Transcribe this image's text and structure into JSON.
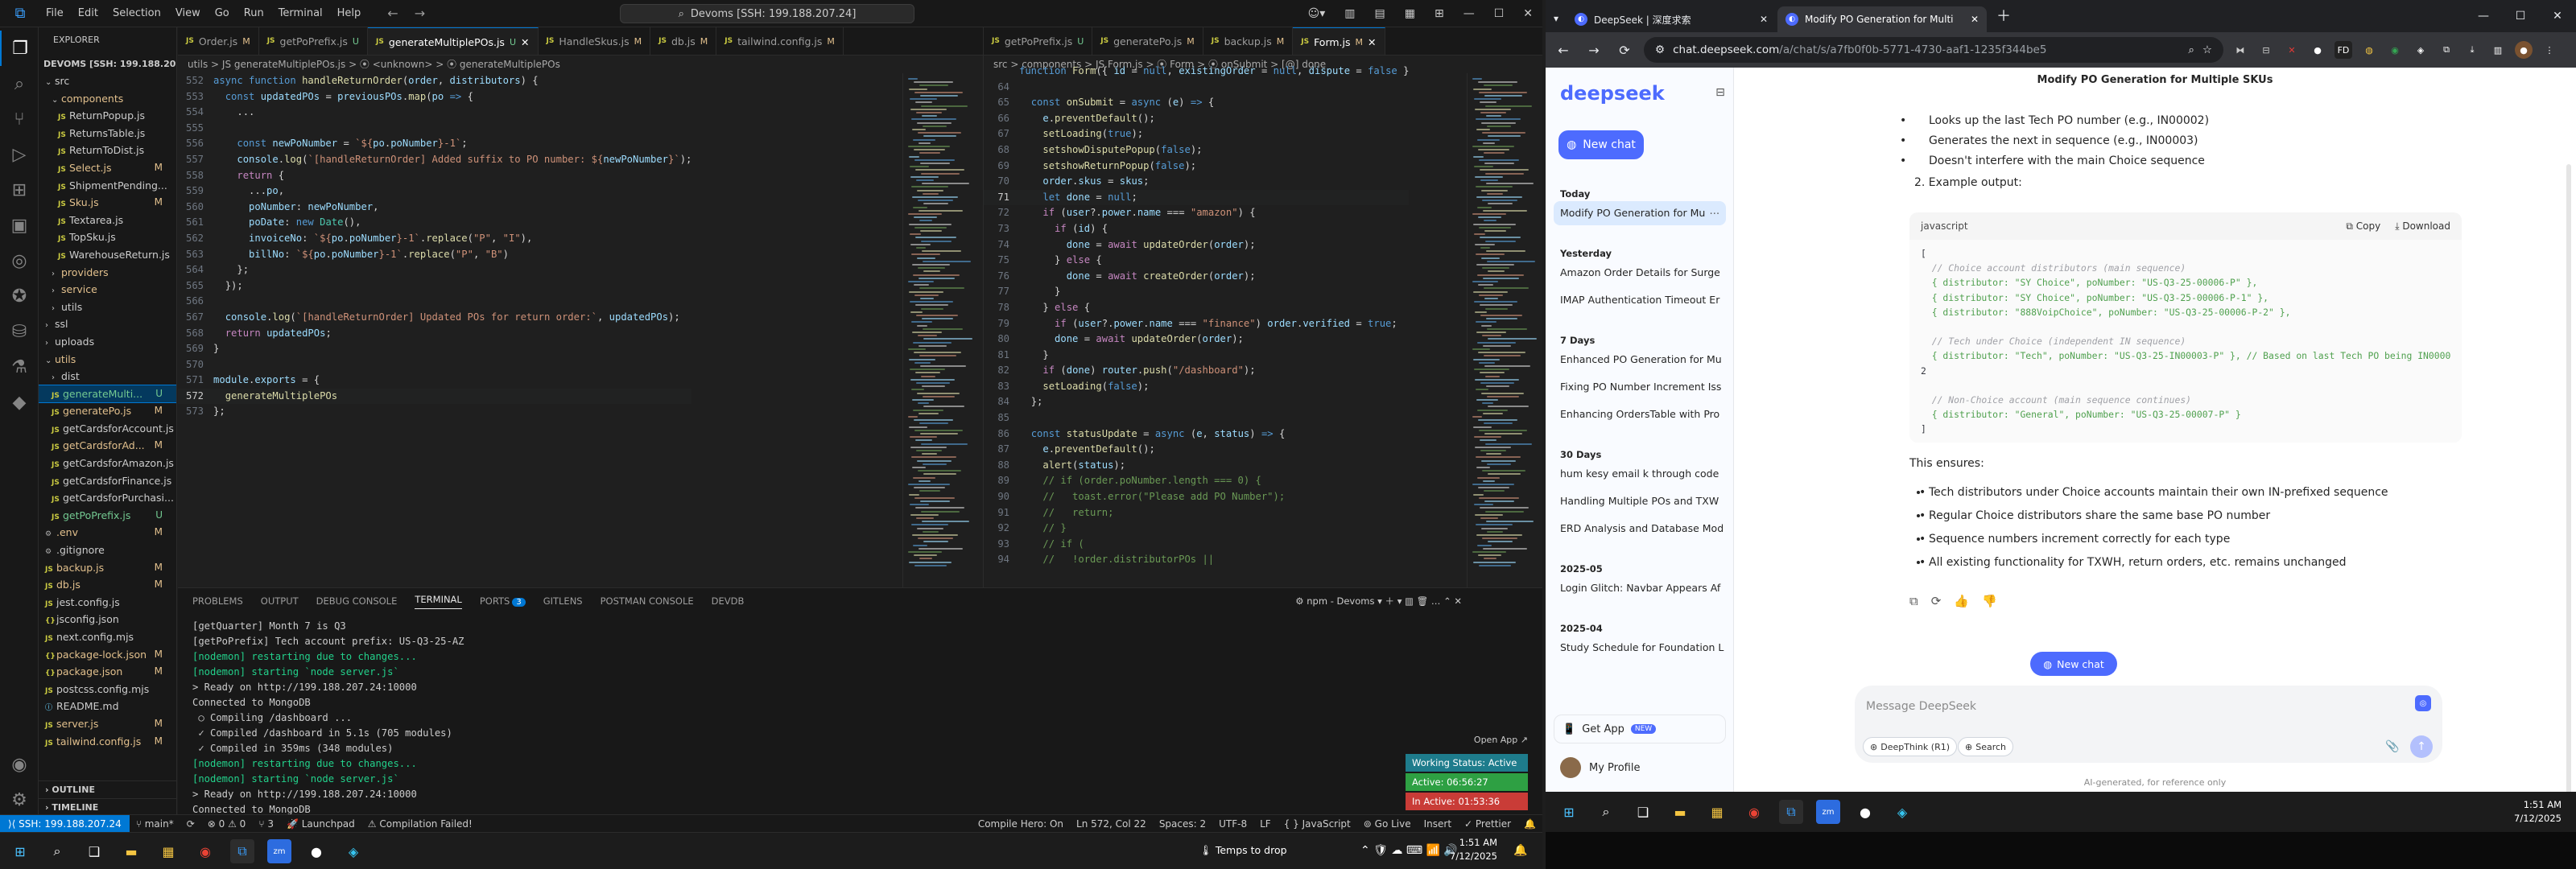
{
  "vscode": {
    "menu": [
      "File",
      "Edit",
      "Selection",
      "View",
      "Go",
      "Run",
      "Terminal",
      "Help"
    ],
    "command_center": "Devoms [SSH: 199.188.207.24]",
    "explorer_label": "EXPLORER",
    "project": "DEVOMS [SSH: 199.188.20...",
    "tree": [
      {
        "label": "src",
        "kind": "folder",
        "indent": 1,
        "open": true,
        "status": "",
        "color": "c-fold"
      },
      {
        "label": "components",
        "kind": "folder",
        "indent": 2,
        "open": true,
        "status": "",
        "color": "c-yellow"
      },
      {
        "label": "ReturnPopup.js",
        "kind": "js",
        "indent": 3,
        "status": "",
        "color": "c-fold"
      },
      {
        "label": "ReturnsTable.js",
        "kind": "js",
        "indent": 3,
        "status": "",
        "color": "c-fold"
      },
      {
        "label": "ReturnToDist.js",
        "kind": "js",
        "indent": 3,
        "status": "",
        "color": "c-fold"
      },
      {
        "label": "Select.js",
        "kind": "js",
        "indent": 3,
        "status": "M",
        "color": "c-mod"
      },
      {
        "label": "ShipmentPending...",
        "kind": "js",
        "indent": 3,
        "status": "",
        "color": "c-fold"
      },
      {
        "label": "Sku.js",
        "kind": "js",
        "indent": 3,
        "status": "M",
        "color": "c-mod"
      },
      {
        "label": "Textarea.js",
        "kind": "js",
        "indent": 3,
        "status": "",
        "color": "c-fold"
      },
      {
        "label": "TopSku.js",
        "kind": "js",
        "indent": 3,
        "status": "",
        "color": "c-fold"
      },
      {
        "label": "WarehouseReturn.js",
        "kind": "js",
        "indent": 3,
        "status": "",
        "color": "c-fold"
      },
      {
        "label": "providers",
        "kind": "folder",
        "indent": 2,
        "open": false,
        "status": "",
        "color": "c-yellow"
      },
      {
        "label": "service",
        "kind": "folder",
        "indent": 2,
        "open": false,
        "status": "",
        "color": "c-yellow"
      },
      {
        "label": "utils",
        "kind": "folder",
        "indent": 2,
        "open": false,
        "status": "",
        "color": "c-fold"
      },
      {
        "label": "ssl",
        "kind": "folder",
        "indent": 1,
        "open": false,
        "status": "",
        "color": "c-fold"
      },
      {
        "label": "uploads",
        "kind": "folder",
        "indent": 1,
        "open": false,
        "status": "",
        "color": "c-fold"
      },
      {
        "label": "utils",
        "kind": "folder",
        "indent": 1,
        "open": true,
        "status": "",
        "color": "c-yellow"
      },
      {
        "label": "dist",
        "kind": "folder",
        "indent": 2,
        "open": false,
        "status": "",
        "color": "c-fold"
      },
      {
        "label": "generateMulti...",
        "kind": "js",
        "indent": 2,
        "status": "U",
        "color": "c-un",
        "selected": true
      },
      {
        "label": "generatePo.js",
        "kind": "js",
        "indent": 2,
        "status": "M",
        "color": "c-mod"
      },
      {
        "label": "getCardsforAccount.js",
        "kind": "js",
        "indent": 2,
        "status": "",
        "color": "c-fold"
      },
      {
        "label": "getCardsforAd...",
        "kind": "js",
        "indent": 2,
        "status": "M",
        "color": "c-mod"
      },
      {
        "label": "getCardsforAmazon.js",
        "kind": "js",
        "indent": 2,
        "status": "",
        "color": "c-fold"
      },
      {
        "label": "getCardsforFinance.js",
        "kind": "js",
        "indent": 2,
        "status": "",
        "color": "c-fold"
      },
      {
        "label": "getCardsforPurchasi...",
        "kind": "js",
        "indent": 2,
        "status": "",
        "color": "c-fold"
      },
      {
        "label": "getPoPrefix.js",
        "kind": "js",
        "indent": 2,
        "status": "U",
        "color": "c-un"
      },
      {
        "label": ".env",
        "kind": "file",
        "indent": 1,
        "status": "M",
        "color": "c-mod"
      },
      {
        "label": ".gitignore",
        "kind": "file",
        "indent": 1,
        "status": "",
        "color": "c-fold"
      },
      {
        "label": "backup.js",
        "kind": "js",
        "indent": 1,
        "status": "M",
        "color": "c-mod"
      },
      {
        "label": "db.js",
        "kind": "js",
        "indent": 1,
        "status": "M",
        "color": "c-mod"
      },
      {
        "label": "jest.config.js",
        "kind": "js",
        "indent": 1,
        "status": "",
        "color": "c-fold"
      },
      {
        "label": "jsconfig.json",
        "kind": "json",
        "indent": 1,
        "status": "",
        "color": "c-fold"
      },
      {
        "label": "next.config.mjs",
        "kind": "js",
        "indent": 1,
        "status": "",
        "color": "c-fold"
      },
      {
        "label": "package-lock.json",
        "kind": "json",
        "indent": 1,
        "status": "M",
        "color": "c-mod"
      },
      {
        "label": "package.json",
        "kind": "json",
        "indent": 1,
        "status": "M",
        "color": "c-mod"
      },
      {
        "label": "postcss.config.mjs",
        "kind": "js",
        "indent": 1,
        "status": "",
        "color": "c-fold"
      },
      {
        "label": "README.md",
        "kind": "md",
        "indent": 1,
        "status": "",
        "color": "c-fold"
      },
      {
        "label": "server.js",
        "kind": "js",
        "indent": 1,
        "status": "M",
        "color": "c-mod"
      },
      {
        "label": "tailwind.config.js",
        "kind": "js",
        "indent": 1,
        "status": "M",
        "color": "c-mod"
      }
    ],
    "outline": "OUTLINE",
    "timeline": "TIMELINE",
    "tabs_left": [
      {
        "label": "Order.js",
        "status": "M",
        "active": false
      },
      {
        "label": "getPoPrefix.js",
        "status": "U",
        "active": false
      },
      {
        "label": "generateMultiplePOs.js",
        "status": "U",
        "active": true
      },
      {
        "label": "HandleSkus.js",
        "status": "M",
        "active": false
      },
      {
        "label": "db.js",
        "status": "M",
        "active": false
      },
      {
        "label": "tailwind.config.js",
        "status": "M",
        "active": false
      }
    ],
    "tabs_right": [
      {
        "label": "getPoPrefix.js",
        "status": "U",
        "active": false
      },
      {
        "label": "generatePo.js",
        "status": "M",
        "active": false
      },
      {
        "label": "backup.js",
        "status": "M",
        "active": false
      },
      {
        "label": "Form.js",
        "status": "M",
        "active": true
      }
    ],
    "breadcrumb_left": "utils > JS generateMultiplePOs.js > ⦿ <unknown> > ⦿ generateMultiplePOs",
    "breadcrumb_right": "src > components > JS Form.js > ⦿ Form > ⦿ onSubmit > [@] done",
    "panel_tabs": [
      "PROBLEMS",
      "OUTPUT",
      "DEBUG CONSOLE",
      "TERMINAL",
      "PORTS",
      "GITLENS",
      "POSTMAN CONSOLE",
      "DEVDB"
    ],
    "ports_badge": "3",
    "terminal_name": "npm - Devoms",
    "terminal_lines": [
      {
        "t": "[getQuarter] Month 7 is Q3",
        "c": "t-w"
      },
      {
        "t": "[getPoPrefix] Tech account prefix: US-Q3-25-AZ",
        "c": "t-w"
      },
      {
        "t": "[nodemon] restarting due to changes...",
        "c": "t-g"
      },
      {
        "t": "[nodemon] starting `node server.js`",
        "c": "t-g"
      },
      {
        "t": "> Ready on http://199.188.207.24:10000",
        "c": "t-w"
      },
      {
        "t": "Connected to MongoDB",
        "c": "t-w"
      },
      {
        "t": " ○ Compiling /dashboard ...",
        "c": "t-w"
      },
      {
        "t": " ✓ Compiled /dashboard in 5.1s (705 modules)",
        "c": "t-w"
      },
      {
        "t": " ✓ Compiled in 359ms (348 modules)",
        "c": "t-w"
      },
      {
        "t": "[nodemon] restarting due to changes...",
        "c": "t-g"
      },
      {
        "t": "[nodemon] starting `node server.js`",
        "c": "t-g"
      },
      {
        "t": "> Ready on http://199.188.207.24:10000",
        "c": "t-w"
      },
      {
        "t": "Connected to MongoDB",
        "c": "t-w"
      },
      {
        "t": "▌",
        "c": "t-w"
      }
    ],
    "open_app": "Open App ↗",
    "working_status": "Working Status: Active",
    "active_time": "Active: 06:56:27",
    "inactive_time": "In Active: 01:53:36",
    "status_bar": {
      "remote": "⟩⟨ SSH: 199.188.207.24",
      "branch": "main*",
      "errors": "⊗ 0 ⚠ 0",
      "ports": "⑂ 3",
      "launchpad": "Launchpad",
      "compile": "Compilation Failed!",
      "compile_hero": "Compile Hero: On",
      "position": "Ln 572, Col 22",
      "spaces": "Spaces: 2",
      "encoding": "UTF-8",
      "eol": "LF",
      "language": "{ } JavaScript",
      "golive": "Go Live",
      "insert": "Insert",
      "prettier": "Prettier",
      "temps": "Temps to drop"
    },
    "clock_time": "1:51 AM",
    "clock_date": "7/12/2025"
  },
  "browser": {
    "tabs": [
      {
        "label": "DeepSeek | 深度求索",
        "active": false
      },
      {
        "label": "Modify PO Generation for Multi",
        "active": true
      }
    ],
    "url_host": "chat.deepseek.com",
    "url_path": "/a/chat/s/a7fb0f0b-5771-4730-aaf1-1235f344be5",
    "logo": "deepseek",
    "new_chat": "New chat",
    "history": [
      {
        "section": "Today",
        "items": [
          "Modify PO Generation for Mu"
        ]
      },
      {
        "section": "Yesterday",
        "items": [
          "Amazon Order Details for Surge",
          "IMAP Authentication Timeout Er"
        ]
      },
      {
        "section": "7 Days",
        "items": [
          "Enhanced PO Generation for Mu",
          "Fixing PO Number Increment Iss",
          "Enhancing OrdersTable with Pro"
        ]
      },
      {
        "section": "30 Days",
        "items": [
          "hum kesy email k through code",
          "Handling Multiple POs and TXW",
          "ERD Analysis and Database Mod"
        ]
      },
      {
        "section": "2025-05",
        "items": [
          "Login Glitch: Navbar Appears Af"
        ]
      },
      {
        "section": "2025-04",
        "items": [
          "Study Schedule for Foundation L"
        ]
      }
    ],
    "get_app": "Get App",
    "new_badge": "NEW",
    "profile": "My Profile",
    "chat_title": "Modify PO Generation for Multiple SKUs",
    "bullets_top": [
      "Looks up the last Tech PO number (e.g., IN00002)",
      "Generates the next in sequence (e.g., IN00003)",
      "Doesn't interfere with the main Choice sequence"
    ],
    "example_label": "2. Example output:",
    "code_lang": "javascript",
    "copy_label": "Copy",
    "download_label": "Download",
    "code_lines": [
      {
        "t": "[",
        "c": "d-p"
      },
      {
        "t": "  // Choice account distributors (main sequence)",
        "c": "d-cm"
      },
      {
        "t": "  { distributor: \"SY Choice\", poNumber: \"US-Q3-25-00006-P\" },",
        "c": "d-s"
      },
      {
        "t": "  { distributor: \"SY Choice\", poNumber: \"US-Q3-25-00006-P-1\" },",
        "c": "d-s"
      },
      {
        "t": "  { distributor: \"888VoipChoice\", poNumber: \"US-Q3-25-00006-P-2\" },",
        "c": "d-s"
      },
      {
        "t": "",
        "c": "d-p"
      },
      {
        "t": "  // Tech under Choice (independent IN sequence)",
        "c": "d-cm"
      },
      {
        "t": "  { distributor: \"Tech\", poNumber: \"US-Q3-25-IN00003-P\" }, // Based on last Tech PO being IN0000",
        "c": "d-s"
      },
      {
        "t": "2",
        "c": "d-p"
      },
      {
        "t": "",
        "c": "d-p"
      },
      {
        "t": "  // Non-Choice account (main sequence continues)",
        "c": "d-cm"
      },
      {
        "t": "  { distributor: \"General\", poNumber: \"US-Q3-25-00007-P\" }",
        "c": "d-s"
      },
      {
        "t": "]",
        "c": "d-p"
      }
    ],
    "ensures_label": "This ensures:",
    "ensures": [
      "Tech distributors under Choice accounts maintain their own IN-prefixed sequence",
      "Regular Choice distributors share the same base PO number",
      "Sequence numbers increment correctly for each type",
      "All existing functionality for TXWH, return orders, etc. remains unchanged"
    ],
    "new_chat_float": "New chat",
    "input_placeholder": "Message DeepSeek",
    "deepthink": "DeepThink (R1)",
    "search": "Search",
    "disclaimer": "AI-generated, for reference only",
    "clock_time": "1:51 AM",
    "clock_date": "7/12/2025"
  },
  "colors": {
    "accent": "#0078d4",
    "deepseek": "#4d6bfe",
    "active_green": "#2ea043",
    "inactive_red": "#c93c37",
    "working_teal": "#1e7c8c"
  }
}
